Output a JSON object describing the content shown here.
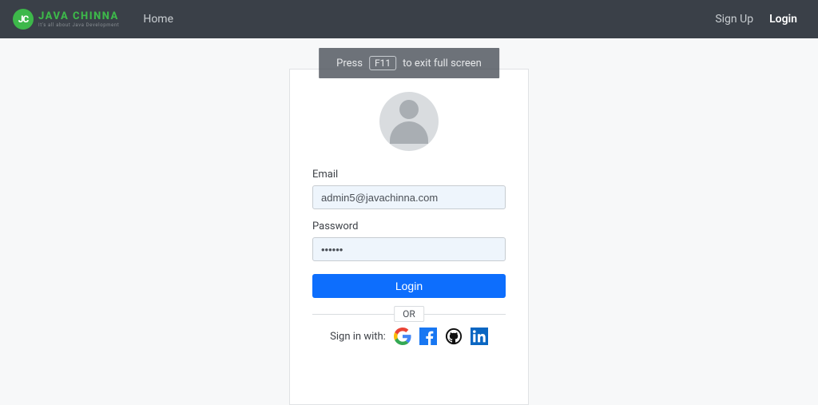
{
  "brand": {
    "initials": "JC",
    "name": "JAVA CHINNA",
    "tagline": "It's all about Java Development"
  },
  "nav": {
    "home": "Home",
    "signup": "Sign Up",
    "login": "Login"
  },
  "fullscreenHint": {
    "pre": "Press",
    "key": "F11",
    "post": "to exit full screen"
  },
  "form": {
    "emailLabel": "Email",
    "emailValue": "admin5@javachinna.com",
    "passwordLabel": "Password",
    "passwordValue": "••••••",
    "loginButton": "Login",
    "divider": "OR",
    "signInWith": "Sign in with:"
  },
  "colors": {
    "primary": "#0d6efd",
    "brandGreen": "#3db84a",
    "facebook": "#1877f2",
    "github": "#111111",
    "linkedin": "#0a66c2"
  }
}
